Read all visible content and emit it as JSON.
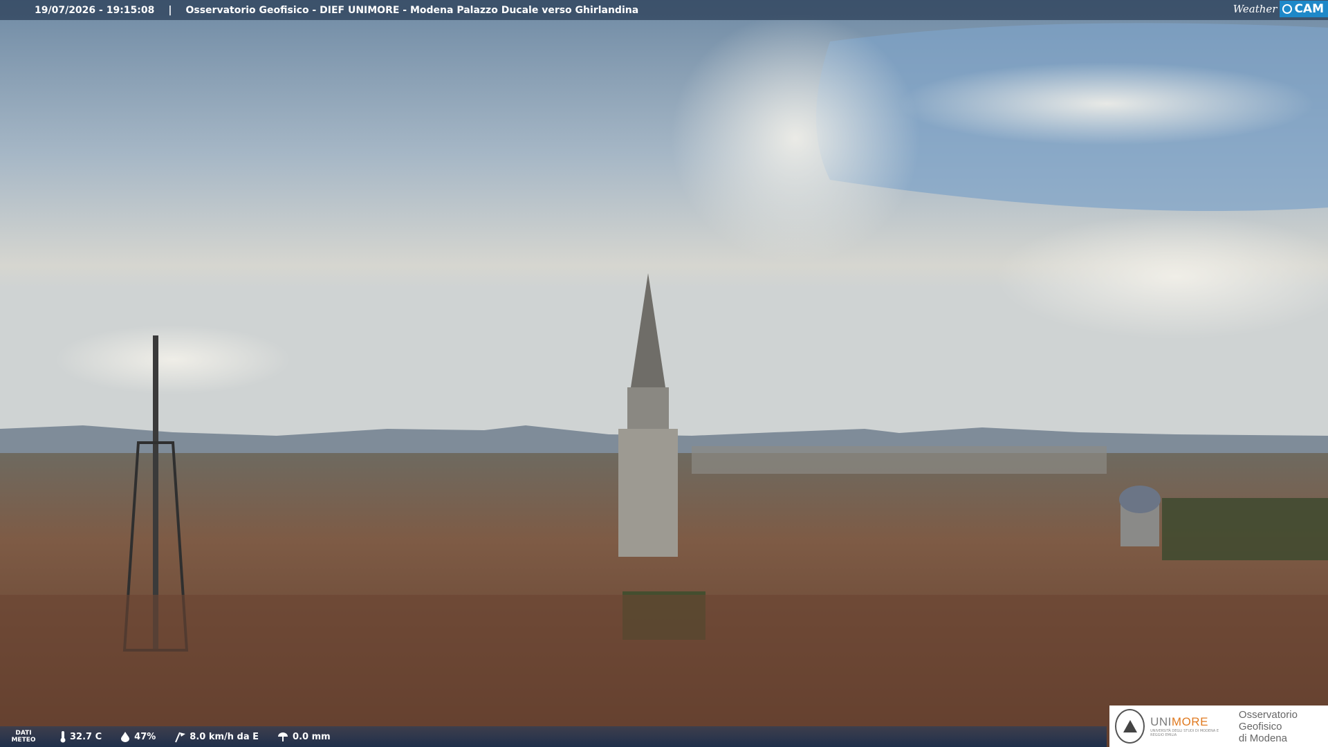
{
  "header": {
    "timestamp": "19/07/2026 - 19:15:08",
    "separator": "|",
    "title": "Osservatorio Geofisico - DIEF UNIMORE - Modena Palazzo Ducale verso Ghirlandina"
  },
  "brand": {
    "weather_label": "Weather",
    "cam_label": "CAM",
    "cam_color": "#1e88c8"
  },
  "meteo": {
    "label_line1": "DATI",
    "label_line2": "METEO",
    "temperature": "32.7 C",
    "humidity": "47%",
    "wind": "8.0 km/h da E",
    "rain": "0.0 mm",
    "icons": [
      "thermometer-icon",
      "humidity-drop-icon",
      "wind-vane-icon",
      "rain-gauge-icon"
    ]
  },
  "footer_logo": {
    "university_prefix": "UNI",
    "university_suffix": "MORE",
    "university_subtitle": "UNIVERSITÀ DEGLI STUDI DI MODENA E REGGIO EMILIA",
    "observatory_line1": "Osservatorio Geofisico",
    "observatory_line2": "di Modena",
    "accent_color": "#e07a20"
  },
  "scene": {
    "subject": "Modena skyline with Ghirlandina tower",
    "sky_color": "#9fb6ca",
    "roof_color": "#8a5a3e"
  }
}
